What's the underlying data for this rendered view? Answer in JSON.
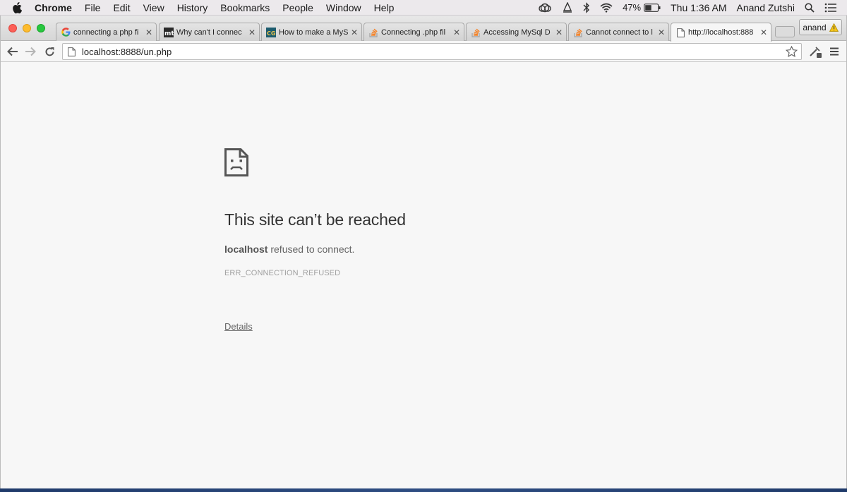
{
  "menubar": {
    "app_name": "Chrome",
    "menus": [
      "File",
      "Edit",
      "View",
      "History",
      "Bookmarks",
      "People",
      "Window",
      "Help"
    ],
    "battery": "47%",
    "clock": "Thu 1:36 AM",
    "user": "Anand Zutshi"
  },
  "tabs": [
    {
      "title": "connecting a php fi",
      "favicon": "google-icon"
    },
    {
      "title": "Why can't I connec",
      "favicon": "mt-icon"
    },
    {
      "title": "How to make a MyS",
      "favicon": "cg-icon"
    },
    {
      "title": "Connecting .php fil",
      "favicon": "stackoverflow-icon"
    },
    {
      "title": "Accessing MySql D",
      "favicon": "stackoverflow-icon"
    },
    {
      "title": "Cannot connect to l",
      "favicon": "stackoverflow-icon"
    },
    {
      "title": "http://localhost:888",
      "favicon": "page-icon"
    }
  ],
  "profile": {
    "name": "anand"
  },
  "omnibox": {
    "host": "localhost",
    "path": ":8888/un.php"
  },
  "error_page": {
    "title": "This site can’t be reached",
    "host": "localhost",
    "message": " refused to connect.",
    "code": "ERR_CONNECTION_REFUSED",
    "details_label": "Details"
  },
  "colors": {
    "close": "#fc5f57",
    "minimize": "#fdbc2e",
    "maximize": "#27c73f",
    "page_bg": "#f7f7f7"
  }
}
